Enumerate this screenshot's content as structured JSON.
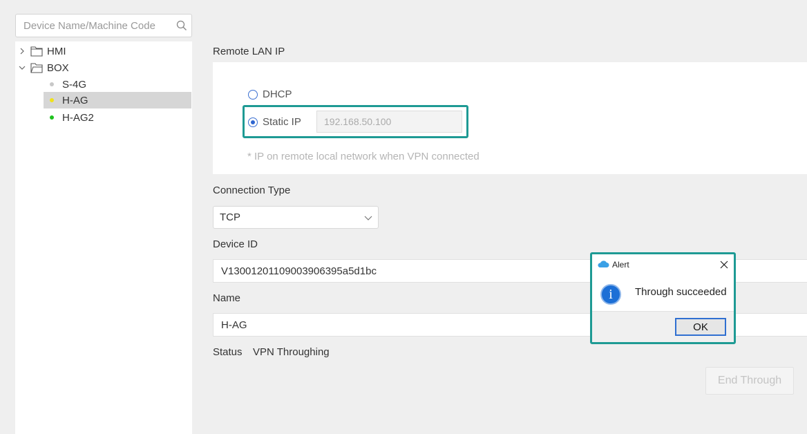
{
  "search": {
    "placeholder": "Device Name/Machine Code"
  },
  "tree": {
    "groups": [
      {
        "label": "HMI",
        "expanded": false
      },
      {
        "label": "BOX",
        "expanded": true
      }
    ],
    "devices": [
      {
        "label": "S-4G",
        "status_color": "#c8c8c8"
      },
      {
        "label": "H-AG",
        "status_color": "#f0e21a",
        "selected": true
      },
      {
        "label": "H-AG2",
        "status_color": "#1fc21f"
      }
    ]
  },
  "remote_lan": {
    "label": "Remote LAN IP",
    "options": [
      {
        "label": "DHCP",
        "checked": false
      },
      {
        "label": "Static IP",
        "checked": true
      }
    ],
    "ip_value": "192.168.50.100",
    "hint": "* IP on remote local network when VPN connected"
  },
  "connection": {
    "label": "Connection Type",
    "value": "TCP"
  },
  "device_id": {
    "label": "Device ID",
    "value": "V13001201109003906395a5d1bc"
  },
  "name": {
    "label": "Name",
    "value": "H-AG"
  },
  "status": {
    "label": "Status",
    "value": "VPN Throughing"
  },
  "end_button": "End Through",
  "alert": {
    "title": "Alert",
    "message": "Through succeeded",
    "ok": "OK"
  },
  "colors": {
    "accent": "#1e9a94",
    "info": "#1c6fd6"
  }
}
